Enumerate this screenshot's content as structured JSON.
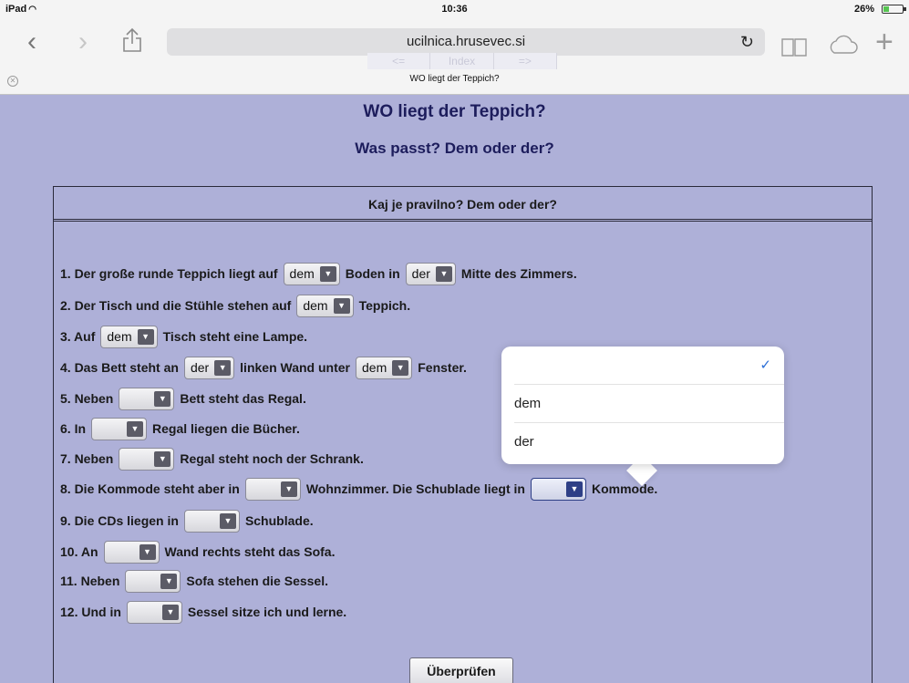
{
  "status_bar": {
    "carrier": "iPad",
    "time": "10:36",
    "battery": "26%"
  },
  "browser": {
    "url": "ucilnica.hrusevec.si",
    "tab_title": "WO liegt der Teppich?",
    "ghost_nav": [
      "<=",
      "Index",
      "=>"
    ]
  },
  "page": {
    "title": "WO liegt der Teppich?",
    "subtitle": "Was passt? Dem oder der?",
    "panel_header": "Kaj je pravilno? Dem oder der?",
    "check_button": "Überprüfen"
  },
  "questions": [
    {
      "label": "1. Der große runde Teppich liegt auf",
      "sel1": "dem",
      "mid": "Boden in",
      "sel2": "der",
      "end": "Mitte des Zimmers."
    },
    {
      "label": "2. Der Tisch und die Stühle stehen auf",
      "sel1": "dem",
      "end": "Teppich."
    },
    {
      "label": "3. Auf",
      "sel1": "dem",
      "end": "Tisch steht eine Lampe."
    },
    {
      "label": "4. Das Bett steht an",
      "sel1": "der",
      "mid": "linken Wand unter",
      "sel2": "dem",
      "end": "Fenster."
    },
    {
      "label": "5. Neben",
      "sel1": "",
      "end": "Bett steht das Regal."
    },
    {
      "label": "6. In",
      "sel1": "",
      "end": "Regal liegen die Bücher."
    },
    {
      "label": "7. Neben",
      "sel1": "",
      "end": "Regal steht noch der Schrank."
    },
    {
      "label": "8. Die Kommode steht aber in",
      "sel1": "",
      "mid": "Wohnzimmer. Die Schublade liegt in",
      "sel2": "",
      "end": "Kommode."
    },
    {
      "label": "9. Die CDs liegen in",
      "sel1": "",
      "end": "Schublade."
    },
    {
      "label": "10. An",
      "sel1": "",
      "end": "Wand rechts steht das Sofa."
    },
    {
      "label": "11. Neben",
      "sel1": "",
      "end": "Sofa stehen die Sessel."
    },
    {
      "label": "12. Und in",
      "sel1": "",
      "end": "Sessel sitze ich und lerne."
    }
  ],
  "dropdown": {
    "options": [
      "",
      "dem",
      "der"
    ],
    "selected_index": 0
  },
  "colors": {
    "page_bg": "#aeb0d8",
    "title": "#1d1d5c",
    "active_select": "#2e3f86",
    "checkmark": "#2c6fd6"
  }
}
